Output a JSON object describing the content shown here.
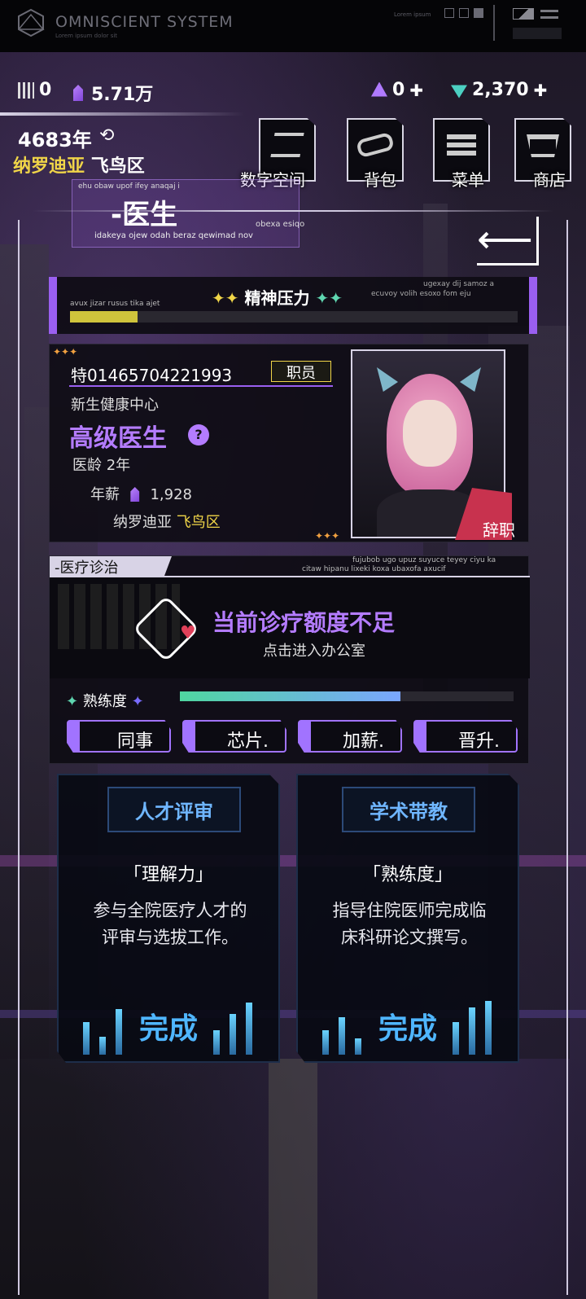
{
  "system": {
    "title": "OMNISCIENT SYSTEM",
    "subtitle": "Lorem ipsum dolor sit",
    "corner_text": "Lorem ipsum"
  },
  "resources": {
    "chips": "0",
    "money": "5.71万",
    "gems": "0",
    "diamonds": "2,370"
  },
  "location": {
    "year": "4683年",
    "city": "纳罗迪亚",
    "district": "飞鸟区"
  },
  "nav": [
    {
      "label": "数字空间",
      "icon": "layers-icon"
    },
    {
      "label": "背包",
      "icon": "bag-icon"
    },
    {
      "label": "菜单",
      "icon": "menu-icon"
    },
    {
      "label": "商店",
      "icon": "cart-icon"
    }
  ],
  "job": {
    "title": "-医生",
    "en_top": "ehu obaw upof ifey anaqaj i",
    "en_bottom": "idakeya ojew odah beraz qewimad nov",
    "en_right": "obexa esiqo"
  },
  "stress": {
    "title": "精神压力",
    "en_left": "avux jizar rusus tika ajet",
    "en_right_1": "ugexay dij samoz a",
    "en_right_2": "ecuvoy volih esoxo fom eju",
    "level": 0.15
  },
  "profile": {
    "id": "特01465704221993",
    "badge": "职员",
    "org": "新生健康中心",
    "rank": "高级医生",
    "age_label": "医龄 2年",
    "salary_label": "年薪",
    "salary": "1,928",
    "city": "纳罗迪亚",
    "district": "飞鸟区",
    "resign": "辞职"
  },
  "medical": {
    "header": "-医疗诊治",
    "en_1": "fujubob ugo upuz suyuce teyey ciyu ka",
    "en_2": "citaw hipanu lixeki koxa ubaxofa axucif",
    "alert": "当前诊疗额度不足",
    "sub": "点击进入办公室",
    "skill_label": "熟练度",
    "skill_level": 0.66
  },
  "actions": [
    "同事",
    "芯片.",
    "加薪.",
    "晋升."
  ],
  "tasks": [
    {
      "header": "人才评审",
      "attr": "「理解力」",
      "desc": "参与全院医疗人才的评审与选拔工作。",
      "status": "完成"
    },
    {
      "header": "学术带教",
      "attr": "「熟练度」",
      "desc": "指导住院医师完成临床科研论文撰写。",
      "status": "完成"
    }
  ],
  "colors": {
    "accent": "#a173ff",
    "gold": "#f0d548",
    "blue": "#4fb6ff",
    "teal": "#5fd6b0"
  }
}
